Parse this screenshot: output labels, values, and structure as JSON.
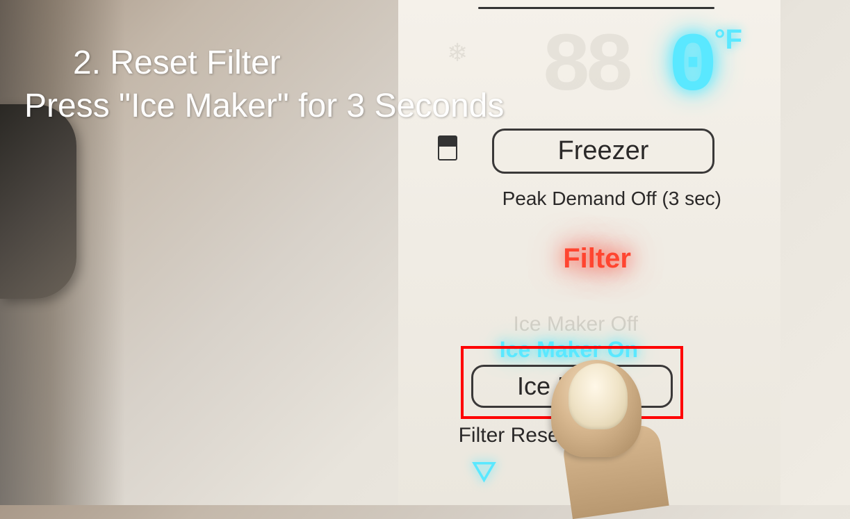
{
  "overlay": {
    "line1": "2. Reset Filter",
    "line2": "Press \"Ice Maker\" for 3 Seconds"
  },
  "display": {
    "temperature": "0",
    "ghost_digits": "88",
    "unit": "°F",
    "top_partial_text": "(3 sec)"
  },
  "buttons": {
    "freezer_label": "Freezer",
    "ice_maker_label": "Ice Maker"
  },
  "labels": {
    "peak_demand": "Peak Demand Off (3 sec)",
    "filter_indicator": "Filter",
    "ice_maker_off": "Ice Maker Off",
    "ice_maker_on": "Ice Maker On",
    "filter_reset": "Filter Reset (3 sec)"
  },
  "icons": {
    "snowflake": "❄",
    "bucket": "⛛"
  }
}
